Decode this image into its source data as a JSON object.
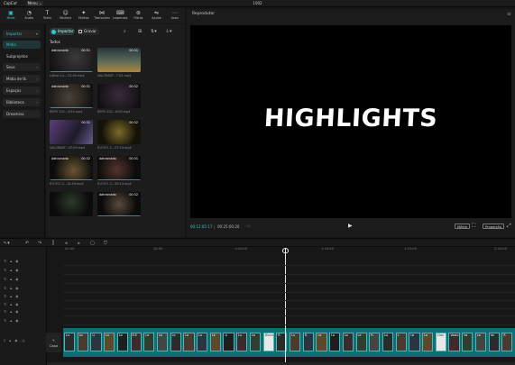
{
  "titlebar": {
    "logo": "CapCut",
    "menu": "Menu ⌄",
    "project": "1002"
  },
  "toolbar": {
    "items": [
      {
        "label": "Mídia",
        "icon": "media-icon",
        "active": true
      },
      {
        "label": "Áudio",
        "icon": "audio-icon"
      },
      {
        "label": "Texto",
        "icon": "text-icon"
      },
      {
        "label": "Stickers",
        "icon": "sticker-icon"
      },
      {
        "label": "Efeitos",
        "icon": "effects-icon"
      },
      {
        "label": "Transições",
        "icon": "transitions-icon"
      },
      {
        "label": "Legendas",
        "icon": "captions-icon"
      },
      {
        "label": "Filtros",
        "icon": "filters-icon"
      },
      {
        "label": "Ajuste",
        "icon": "adjust-icon"
      },
      {
        "label": "Avan",
        "icon": "advanced-icon"
      }
    ]
  },
  "leftnav": {
    "items": [
      "Importar",
      "Mídia",
      "Subprojetos",
      "Seus",
      "Mídia de tk",
      "Espaços",
      "Biblioteca",
      "Dreamina"
    ]
  },
  "media": {
    "import_label": "Importar",
    "record_label": "Gravar",
    "all_label": "Todos",
    "items": [
      {
        "badge": "Adicionado",
        "dur": "00:51",
        "name": "Lethal Co...:33:00.mp4"
      },
      {
        "badge": "",
        "dur": "00:31",
        "name": "VALORANT...7:02.mp4"
      },
      {
        "badge": "Adicionado",
        "dur": "00:31",
        "name": "REPO 202...4:54.mp4"
      },
      {
        "badge": "",
        "dur": "00:32",
        "name": "REPO 202...6:00.mp4"
      },
      {
        "badge": "",
        "dur": "00:31",
        "name": "VALORANT...47:59.mp4"
      },
      {
        "badge": "",
        "dur": "00:32",
        "name": "R.E.P.O. 2...07:24.mp4"
      },
      {
        "badge": "Adicionado",
        "dur": "00:32",
        "name": "R.E.P.O. 2...14:59.mp4"
      },
      {
        "badge": "Adicionado",
        "dur": "00:31",
        "name": "R.E.P.O. 2...40:14.mp4"
      },
      {
        "badge": "",
        "dur": "",
        "name": ""
      },
      {
        "badge": "Adicionado",
        "dur": "00:32",
        "name": ""
      }
    ]
  },
  "player": {
    "title": "Reprodutor",
    "headline": "HIGHLIGHTS",
    "time_current": "00:12:05:17",
    "time_total": "00:25:00:20",
    "btn_full": "Média",
    "btn_ratio": "Proporção"
  },
  "timeline": {
    "ruler": [
      "00:00",
      "10:00",
      "1:00:00",
      "1:10:00",
      "1:20:00",
      "2:30:00"
    ],
    "cover_label": "Capa",
    "clips": [
      "Lu",
      "Lo",
      "Li",
      "Lu",
      "Lo",
      "R.E",
      "Le",
      "Lo",
      "Le",
      "Le",
      "Lo",
      "Le",
      "Li",
      "Lu",
      "Le",
      "Discor",
      "R",
      "Lu",
      "R.",
      "Le",
      "Lo",
      "Lo",
      "Le",
      "R.",
      "Lo",
      "L",
      "Le",
      "Lo",
      "Clas",
      "Vazio",
      "Va",
      "Le",
      "Vo",
      "R"
    ],
    "accent": "#0f6f73"
  }
}
